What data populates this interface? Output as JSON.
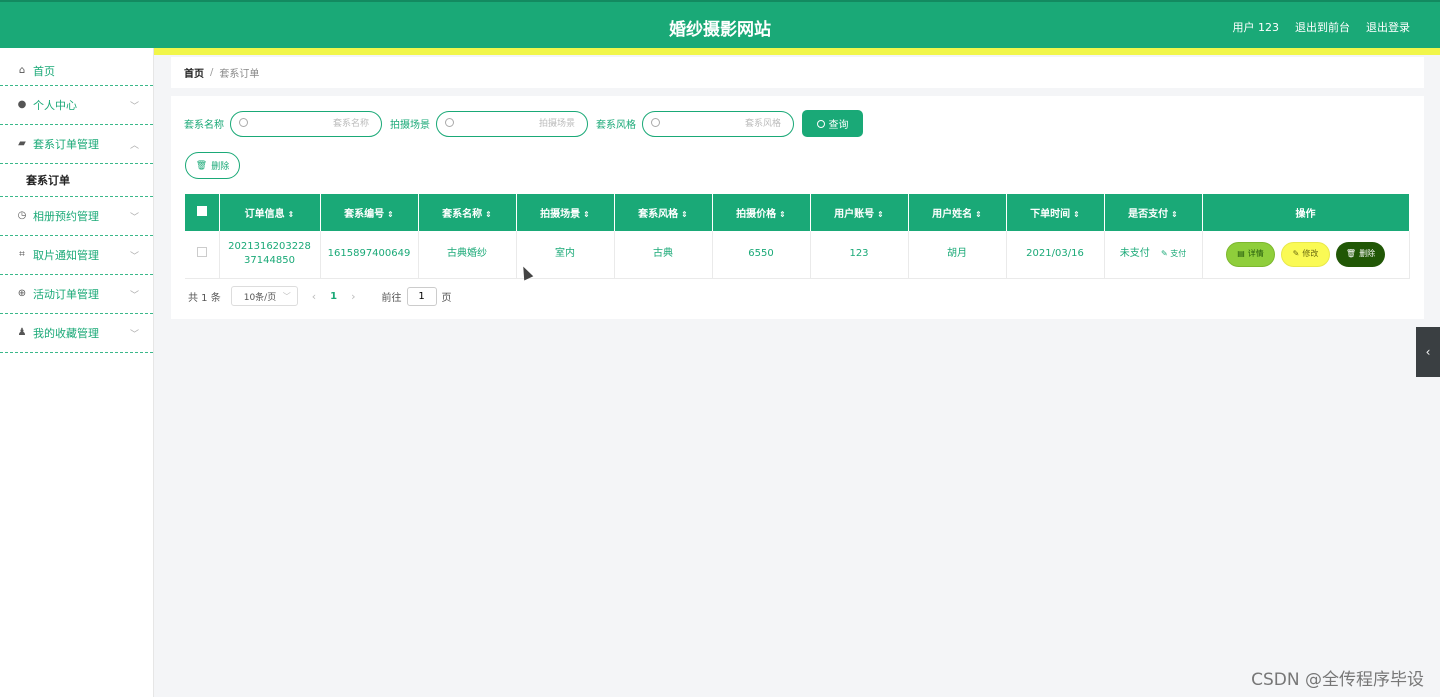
{
  "header": {
    "title": "婚纱摄影网站",
    "user": "用户 123",
    "to_front": "退出到前台",
    "logout": "退出登录"
  },
  "sidebar": {
    "items": [
      {
        "label": "首页",
        "icon": "home-icon"
      },
      {
        "label": "个人中心",
        "icon": "user-icon"
      },
      {
        "label": "套系订单管理",
        "icon": "folder-icon"
      },
      {
        "label": "相册预约管理",
        "icon": "clock-icon"
      },
      {
        "label": "取片通知管理",
        "icon": "crop-icon"
      },
      {
        "label": "活动订单管理",
        "icon": "target-icon"
      },
      {
        "label": "我的收藏管理",
        "icon": "person-icon"
      }
    ],
    "sub_item": "套系订单"
  },
  "breadcrumb": {
    "home": "首页",
    "sep": "/",
    "current": "套系订单"
  },
  "search": {
    "field1_label": "套系名称",
    "field1_placeholder": "套系名称",
    "field2_label": "拍摄场景",
    "field2_placeholder": "拍摄场景",
    "field3_label": "套系风格",
    "field3_placeholder": "套系风格",
    "query_label": "查询"
  },
  "actions": {
    "delete_label": "删除"
  },
  "table": {
    "headers": [
      "订单信息",
      "套系编号",
      "套系名称",
      "拍摄场景",
      "套系风格",
      "拍摄价格",
      "用户账号",
      "用户姓名",
      "下单时间",
      "是否支付",
      "操作"
    ],
    "rows": [
      {
        "order_info": "202131620322837144850",
        "package_no": "1615897400649",
        "package_name": "古典婚纱",
        "scene": "室内",
        "style": "古典",
        "price": "6550",
        "account": "123",
        "name": "胡月",
        "order_time": "2021/03/16",
        "paid": "未支付",
        "pay_link": "支付",
        "detail": "详情",
        "edit": "修改",
        "delete": "删除"
      }
    ]
  },
  "pager": {
    "total": "共 1 条",
    "page_size": "10条/页",
    "current_page": "1",
    "goto_label": "前往",
    "goto_value": "1",
    "page_suffix": "页"
  },
  "watermark": "CSDN @全传程序毕设",
  "colors": {
    "primary": "#1aa977",
    "stripe": "#f1f64a",
    "detail_btn": "#8fce3b",
    "edit_btn": "#fafa55",
    "delete_btn": "#215706"
  }
}
